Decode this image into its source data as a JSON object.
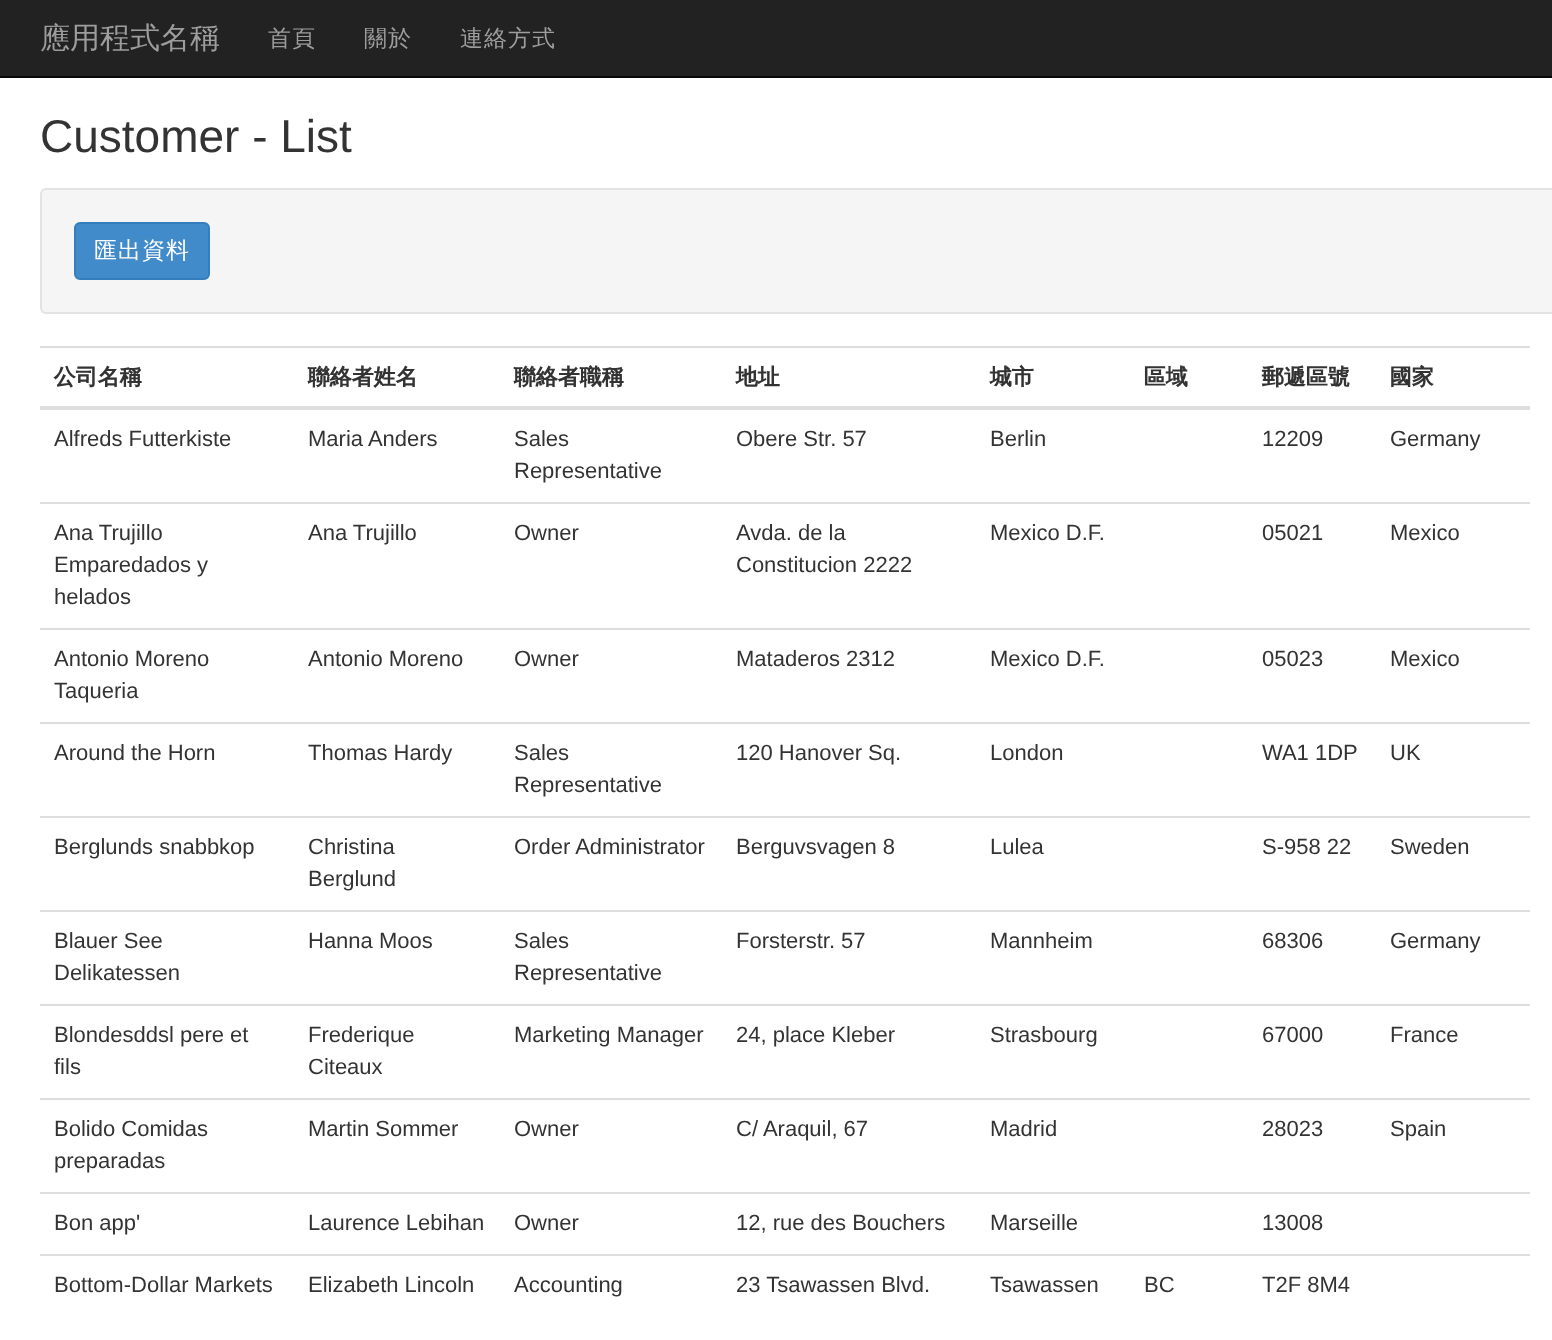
{
  "navbar": {
    "brand": "應用程式名稱",
    "links": [
      "首頁",
      "關於",
      "連絡方式"
    ]
  },
  "title": "Customer - List",
  "toolbar": {
    "export_button": "匯出資料"
  },
  "table": {
    "columns": [
      "公司名稱",
      "聯絡者姓名",
      "聯絡者職稱",
      "地址",
      "城市",
      "區域",
      "郵遞區號",
      "國家"
    ],
    "rows": [
      [
        "Alfreds Futterkiste",
        "Maria Anders",
        "Sales Representative",
        "Obere Str. 57",
        "Berlin",
        null,
        "12209",
        "Germany"
      ],
      [
        "Ana Trujillo Emparedados y helados",
        "Ana Trujillo",
        "Owner",
        "Avda. de la Constitucion 2222",
        "Mexico D.F.",
        null,
        "05021",
        "Mexico"
      ],
      [
        "Antonio Moreno Taqueria",
        "Antonio Moreno",
        "Owner",
        "Mataderos 2312",
        "Mexico D.F.",
        null,
        "05023",
        "Mexico"
      ],
      [
        "Around the Horn",
        "Thomas Hardy",
        "Sales Representative",
        "120 Hanover Sq.",
        "London",
        null,
        "WA1 1DP",
        "UK"
      ],
      [
        "Berglunds snabbkop",
        "Christina Berglund",
        "Order Administrator",
        "Berguvsvagen 8",
        "Lulea",
        null,
        "S-958 22",
        "Sweden"
      ],
      [
        "Blauer See Delikatessen",
        "Hanna Moos",
        "Sales Representative",
        "Forsterstr. 57",
        "Mannheim",
        null,
        "68306",
        "Germany"
      ],
      [
        "Blondesddsl pere et fils",
        "Frederique Citeaux",
        "Marketing Manager",
        "24, place Kleber",
        "Strasbourg",
        null,
        "67000",
        "France"
      ],
      [
        "Bolido Comidas preparadas",
        "Martin Sommer",
        "Owner",
        "C/ Araquil, 67",
        "Madrid",
        null,
        "28023",
        "Spain"
      ],
      [
        "Bon app'",
        "Laurence Lebihan",
        "Owner",
        "12, rue des Bouchers",
        "Marseille",
        null,
        "13008",
        null
      ],
      [
        "Bottom-Dollar Markets",
        "Elizabeth Lincoln",
        "Accounting",
        "23 Tsawassen Blvd.",
        "Tsawassen",
        "BC",
        "T2F 8M4",
        null
      ]
    ]
  }
}
